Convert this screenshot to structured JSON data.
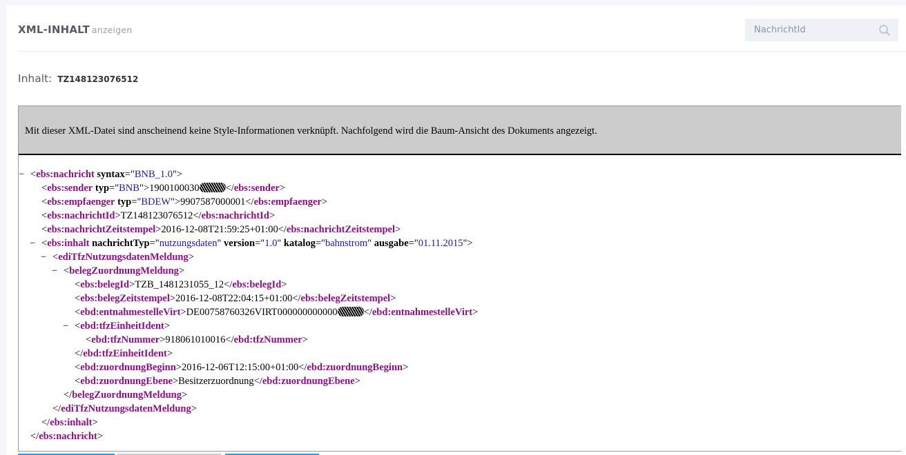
{
  "header": {
    "title": "XML-INHALT",
    "subtitle": "anzeigen",
    "search_placeholder": "NachrichtId"
  },
  "inhalt": {
    "label": "Inhalt:",
    "id": "TZ148123076512"
  },
  "xml_viewer": {
    "notice": "Mit dieser XML-Datei sind anscheinend keine Style-Informationen verknüpft. Nachfolgend wird die Baum-Ansicht des Dokuments angezeigt.",
    "fold_symbol": "−",
    "lines": [
      {
        "indent": 0,
        "fold": true,
        "parts": [
          [
            "p",
            "<"
          ],
          [
            "t",
            "ebs:nachricht"
          ],
          [
            "p",
            " "
          ],
          [
            "an",
            "syntax"
          ],
          [
            "p",
            "=\""
          ],
          [
            "av",
            "BNB_1.0"
          ],
          [
            "p",
            "\">"
          ]
        ]
      },
      {
        "indent": 1,
        "fold": false,
        "parts": [
          [
            "p",
            "<"
          ],
          [
            "t",
            "ebs:sender"
          ],
          [
            "p",
            " "
          ],
          [
            "an",
            "typ"
          ],
          [
            "p",
            "=\""
          ],
          [
            "av",
            "BNB"
          ],
          [
            "p",
            "\">1900100030"
          ],
          [
            "r",
            ""
          ],
          [
            "p",
            "</"
          ],
          [
            "t",
            "ebs:sender"
          ],
          [
            "p",
            ">"
          ]
        ]
      },
      {
        "indent": 1,
        "fold": false,
        "parts": [
          [
            "p",
            "<"
          ],
          [
            "t",
            "ebs:empfaenger"
          ],
          [
            "p",
            " "
          ],
          [
            "an",
            "typ"
          ],
          [
            "p",
            "=\""
          ],
          [
            "av",
            "BDEW"
          ],
          [
            "p",
            "\">9907587000001</"
          ],
          [
            "t",
            "ebs:empfaenger"
          ],
          [
            "p",
            ">"
          ]
        ]
      },
      {
        "indent": 1,
        "fold": false,
        "parts": [
          [
            "p",
            "<"
          ],
          [
            "t",
            "ebs:nachrichtId"
          ],
          [
            "p",
            ">TZ148123076512</"
          ],
          [
            "t",
            "ebs:nachrichtId"
          ],
          [
            "p",
            ">"
          ]
        ]
      },
      {
        "indent": 1,
        "fold": false,
        "parts": [
          [
            "p",
            "<"
          ],
          [
            "t",
            "ebs:nachrichtZeitstempel"
          ],
          [
            "p",
            ">2016-12-08T21:59:25+01:00</"
          ],
          [
            "t",
            "ebs:nachrichtZeitstempel"
          ],
          [
            "p",
            ">"
          ]
        ]
      },
      {
        "indent": 1,
        "fold": true,
        "parts": [
          [
            "p",
            "<"
          ],
          [
            "t",
            "ebs:inhalt"
          ],
          [
            "p",
            " "
          ],
          [
            "an",
            "nachrichtTyp"
          ],
          [
            "p",
            "=\""
          ],
          [
            "av",
            "nutzungsdaten"
          ],
          [
            "p",
            "\" "
          ],
          [
            "an",
            "version"
          ],
          [
            "p",
            "=\""
          ],
          [
            "av",
            "1.0"
          ],
          [
            "p",
            "\" "
          ],
          [
            "an",
            "katalog"
          ],
          [
            "p",
            "=\""
          ],
          [
            "av",
            "bahnstrom"
          ],
          [
            "p",
            "\" "
          ],
          [
            "an",
            "ausgabe"
          ],
          [
            "p",
            "=\""
          ],
          [
            "av",
            "01.11.2015"
          ],
          [
            "p",
            "\">"
          ]
        ]
      },
      {
        "indent": 2,
        "fold": true,
        "parts": [
          [
            "p",
            "<"
          ],
          [
            "t",
            "ediTfzNutzungsdatenMeldung"
          ],
          [
            "p",
            ">"
          ]
        ]
      },
      {
        "indent": 3,
        "fold": true,
        "parts": [
          [
            "p",
            "<"
          ],
          [
            "t",
            "belegZuordnungMeldung"
          ],
          [
            "p",
            ">"
          ]
        ]
      },
      {
        "indent": 4,
        "fold": false,
        "parts": [
          [
            "p",
            "<"
          ],
          [
            "t",
            "ebs:belegId"
          ],
          [
            "p",
            ">TZB_1481231055_12</"
          ],
          [
            "t",
            "ebs:belegId"
          ],
          [
            "p",
            ">"
          ]
        ]
      },
      {
        "indent": 4,
        "fold": false,
        "parts": [
          [
            "p",
            "<"
          ],
          [
            "t",
            "ebs:belegZeitstempel"
          ],
          [
            "p",
            ">2016-12-08T22:04:15+01:00</"
          ],
          [
            "t",
            "ebs:belegZeitstempel"
          ],
          [
            "p",
            ">"
          ]
        ]
      },
      {
        "indent": 4,
        "fold": false,
        "parts": [
          [
            "p",
            "<"
          ],
          [
            "t",
            "ebd:entnahmestelleVirt"
          ],
          [
            "p",
            ">DE00758760326VIRT000000000000"
          ],
          [
            "r",
            ""
          ],
          [
            "p",
            "</"
          ],
          [
            "t",
            "ebd:entnahmestelleVirt"
          ],
          [
            "p",
            ">"
          ]
        ]
      },
      {
        "indent": 4,
        "fold": true,
        "parts": [
          [
            "p",
            "<"
          ],
          [
            "t",
            "ebd:tfzEinheitIdent"
          ],
          [
            "p",
            ">"
          ]
        ]
      },
      {
        "indent": 5,
        "fold": false,
        "parts": [
          [
            "p",
            "<"
          ],
          [
            "t",
            "ebd:tfzNummer"
          ],
          [
            "p",
            ">918061010016</"
          ],
          [
            "t",
            "ebd:tfzNummer"
          ],
          [
            "p",
            ">"
          ]
        ]
      },
      {
        "indent": 4,
        "fold": false,
        "parts": [
          [
            "p",
            "</"
          ],
          [
            "t",
            "ebd:tfzEinheitIdent"
          ],
          [
            "p",
            ">"
          ]
        ]
      },
      {
        "indent": 4,
        "fold": false,
        "parts": [
          [
            "p",
            "<"
          ],
          [
            "t",
            "ebd:zuordnungBeginn"
          ],
          [
            "p",
            ">2016-12-06T12:15:00+01:00</"
          ],
          [
            "t",
            "ebd:zuordnungBeginn"
          ],
          [
            "p",
            ">"
          ]
        ]
      },
      {
        "indent": 4,
        "fold": false,
        "parts": [
          [
            "p",
            "<"
          ],
          [
            "t",
            "ebd:zuordnungEbene"
          ],
          [
            "p",
            ">Besitzerzuordnung</"
          ],
          [
            "t",
            "ebd:zuordnungEbene"
          ],
          [
            "p",
            ">"
          ]
        ]
      },
      {
        "indent": 3,
        "fold": false,
        "parts": [
          [
            "p",
            "</"
          ],
          [
            "t",
            "belegZuordnungMeldung"
          ],
          [
            "p",
            ">"
          ]
        ]
      },
      {
        "indent": 2,
        "fold": false,
        "parts": [
          [
            "p",
            "</"
          ],
          [
            "t",
            "ediTfzNutzungsdatenMeldung"
          ],
          [
            "p",
            ">"
          ]
        ]
      },
      {
        "indent": 1,
        "fold": false,
        "parts": [
          [
            "p",
            "</"
          ],
          [
            "t",
            "ebs:inhalt"
          ],
          [
            "p",
            ">"
          ]
        ]
      },
      {
        "indent": 0,
        "fold": false,
        "parts": [
          [
            "p",
            "</"
          ],
          [
            "t",
            "ebs:nachricht"
          ],
          [
            "p",
            ">"
          ]
        ]
      }
    ]
  },
  "colors": {
    "tag": "#881280",
    "attr_value": "#1a1aa6",
    "notice_bg": "#cccccc",
    "accent": "#3598dc"
  },
  "icons": {
    "search": "search-icon"
  }
}
